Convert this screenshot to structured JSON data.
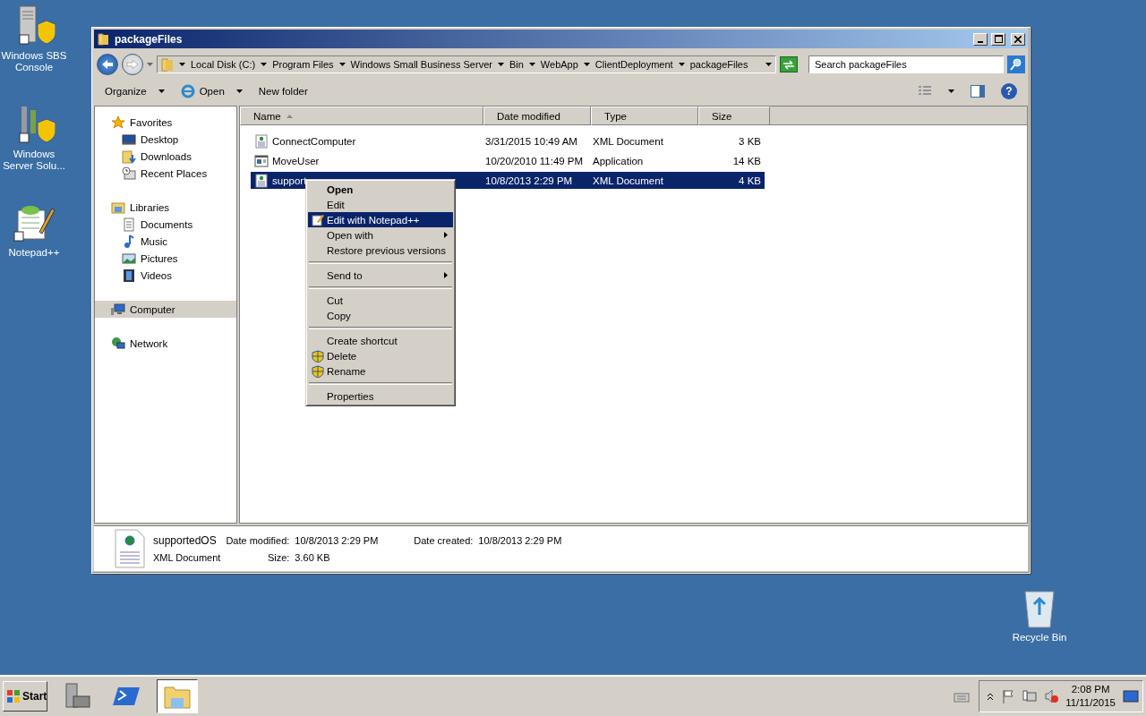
{
  "desktop_icons": [
    {
      "label": "Windows SBS Console",
      "kind": "server"
    },
    {
      "label": "Windows Server Solu...",
      "kind": "tools"
    },
    {
      "label": "Notepad++",
      "kind": "notepad"
    },
    {
      "label": "Recycle Bin",
      "kind": "recycle"
    }
  ],
  "window": {
    "title": "packageFiles",
    "address": [
      "Local Disk (C:)",
      "Program Files",
      "Windows Small Business Server",
      "Bin",
      "WebApp",
      "ClientDeployment",
      "packageFiles"
    ],
    "search": {
      "placeholder": "Search packageFiles"
    },
    "help": "?",
    "toolbar": [
      {
        "label": "Organize",
        "kind": "menu"
      },
      {
        "label": "Open",
        "kind": "open"
      },
      {
        "label": "New folder",
        "kind": "plain"
      }
    ],
    "nav": [
      {
        "label": "Favorites",
        "kind": "star",
        "selected": false,
        "children": [
          {
            "label": "Desktop",
            "kind": "desktop",
            "selected": false
          },
          {
            "label": "Downloads",
            "kind": "downloads",
            "selected": false
          },
          {
            "label": "Recent Places",
            "kind": "recent",
            "selected": false
          }
        ]
      },
      {
        "label": "Libraries",
        "kind": "library",
        "selected": false,
        "children": [
          {
            "label": "Documents",
            "kind": "document",
            "selected": false
          },
          {
            "label": "Music",
            "kind": "music",
            "selected": false
          },
          {
            "label": "Pictures",
            "kind": "pictures",
            "selected": false
          },
          {
            "label": "Videos",
            "kind": "videos",
            "selected": false
          }
        ]
      },
      {
        "label": "Computer",
        "kind": "computer",
        "selected": true
      },
      {
        "label": "Network",
        "kind": "network",
        "selected": false
      }
    ],
    "columns": [
      {
        "label": "Name",
        "sorted": true
      },
      {
        "label": "Date modified",
        "sorted": false
      },
      {
        "label": "Type",
        "sorted": false
      },
      {
        "label": "Size",
        "sorted": false
      }
    ],
    "rows": [
      {
        "name": "ConnectComputer",
        "date": "3/31/2015 10:49 AM",
        "type": "XML Document",
        "size": "3 KB",
        "kind": "xml",
        "selected": false
      },
      {
        "name": "MoveUser",
        "date": "10/20/2010 11:49 PM",
        "type": "Application",
        "size": "14 KB",
        "kind": "app",
        "selected": false
      },
      {
        "name": "support",
        "date": "10/8/2013 2:29 PM",
        "type": "XML Document",
        "size": "4 KB",
        "kind": "xml",
        "selected": true
      }
    ],
    "details": {
      "name": "supportedOS",
      "type": "XML Document",
      "fields": [
        {
          "label": "Date modified:",
          "value": "10/8/2013 2:29 PM"
        },
        {
          "label": "Size:",
          "value": "3.60 KB"
        },
        {
          "label": "Date created:",
          "value": "10/8/2013 2:29 PM"
        }
      ]
    }
  },
  "context_menu": [
    {
      "kind": "item",
      "label": "Open",
      "bold": true,
      "selected": false,
      "submenu": false
    },
    {
      "kind": "item",
      "label": "Edit",
      "bold": false,
      "selected": false,
      "submenu": false
    },
    {
      "kind": "notepad",
      "label": "Edit with Notepad++",
      "bold": false,
      "selected": true,
      "submenu": false
    },
    {
      "kind": "item",
      "label": "Open with",
      "bold": false,
      "selected": false,
      "submenu": true
    },
    {
      "kind": "item",
      "label": "Restore previous versions",
      "bold": false,
      "selected": false,
      "submenu": false
    },
    {
      "kind": "separator"
    },
    {
      "kind": "item",
      "label": "Send to",
      "bold": false,
      "selected": false,
      "submenu": true
    },
    {
      "kind": "separator"
    },
    {
      "kind": "item",
      "label": "Cut",
      "bold": false,
      "selected": false,
      "submenu": false
    },
    {
      "kind": "item",
      "label": "Copy",
      "bold": false,
      "selected": false,
      "submenu": false
    },
    {
      "kind": "separator"
    },
    {
      "kind": "item",
      "label": "Create shortcut",
      "bold": false,
      "selected": false,
      "submenu": false
    },
    {
      "kind": "shield",
      "label": "Delete",
      "bold": false,
      "selected": false,
      "submenu": false
    },
    {
      "kind": "shield",
      "label": "Rename",
      "bold": false,
      "selected": false,
      "submenu": false
    },
    {
      "kind": "separator"
    },
    {
      "kind": "item",
      "label": "Properties",
      "bold": false,
      "selected": false,
      "submenu": false
    }
  ],
  "taskbar": {
    "start": "Start",
    "apps": [
      {
        "kind": "tools",
        "selected": false
      },
      {
        "kind": "powershell",
        "selected": false
      },
      {
        "kind": "explorer",
        "selected": true
      }
    ],
    "time": "2:08 PM",
    "date": "11/11/2015"
  }
}
